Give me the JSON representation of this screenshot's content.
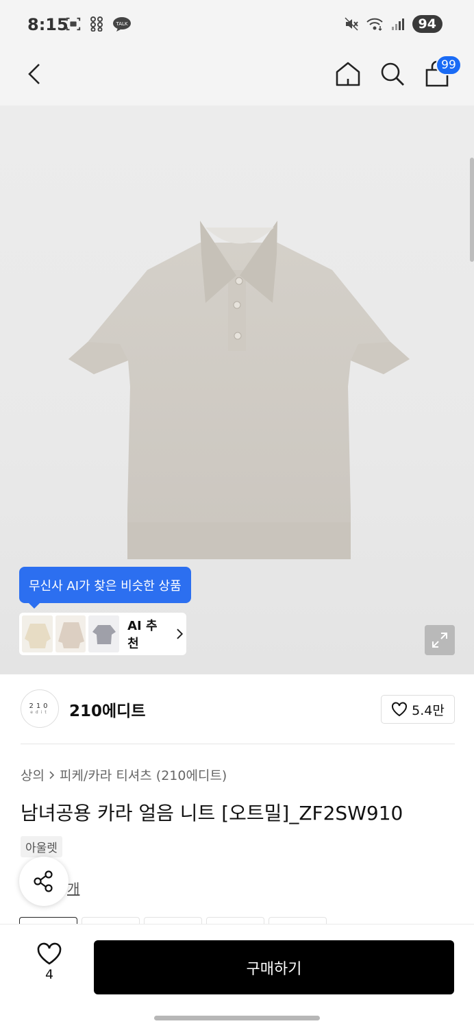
{
  "status_bar": {
    "time": "8:15",
    "talk_badge": "TALK",
    "battery": "94",
    "icons": [
      "screenshot-icon",
      "grid-icon",
      "talk-icon",
      "mute-icon",
      "wifi-icon",
      "signal-icon"
    ]
  },
  "header": {
    "icons": [
      "back-icon",
      "home-icon",
      "search-icon",
      "cart-icon"
    ],
    "cart_count": "99"
  },
  "hero": {
    "ai_tooltip": "무신사 AI가 찾은 비슷한 상품",
    "ai_rec_label": "AI 추천",
    "thumb_colors": [
      "#ece3d0",
      "#e9ddd2",
      "#d8d9dc"
    ]
  },
  "brand": {
    "logo_top": "210",
    "logo_bottom": "edit",
    "name": "210에디트",
    "like_count": "5.4만"
  },
  "product": {
    "breadcrumb": [
      "상의",
      "피케/카라 티셔츠 (210에디트)"
    ],
    "title": "남녀공용 카라 얼음 니트 [오트밀]_ZF2SW910",
    "tag": "아울렛",
    "review_suffix": "개"
  },
  "bottom": {
    "wish_count": "4",
    "buy_label": "구매하기"
  },
  "colors": {
    "accent": "#2c6ff0",
    "badge": "#1a6bf5",
    "buy": "#000000"
  }
}
